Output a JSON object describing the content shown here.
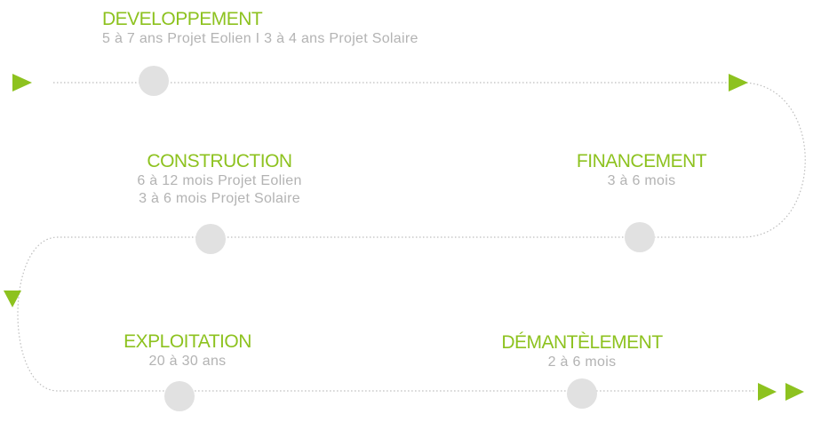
{
  "colors": {
    "accent": "#8dc21f",
    "node": "#e1e1e1",
    "detail_text": "#b3b3b3",
    "path": "#bdbdbd"
  },
  "stages": [
    {
      "title": "DEVELOPPEMENT",
      "details": [
        "5 à 7 ans Projet Eolien I 3 à 4 ans Projet Solaire"
      ]
    },
    {
      "title": "FINANCEMENT",
      "details": [
        "3 à 6 mois"
      ]
    },
    {
      "title": "CONSTRUCTION",
      "details": [
        "6 à 12 mois Projet Eolien",
        "3 à 6 mois Projet Solaire"
      ]
    },
    {
      "title": "EXPLOITATION",
      "details": [
        "20 à 30 ans"
      ]
    },
    {
      "title": "DÉMANTÈLEMENT",
      "details": [
        "2 à 6 mois"
      ]
    }
  ],
  "icons": {
    "start": "play-arrow-icon",
    "turn_right": "play-arrow-icon",
    "turn_left": "play-arrow-down-icon",
    "end": "double-play-arrow-icon"
  }
}
